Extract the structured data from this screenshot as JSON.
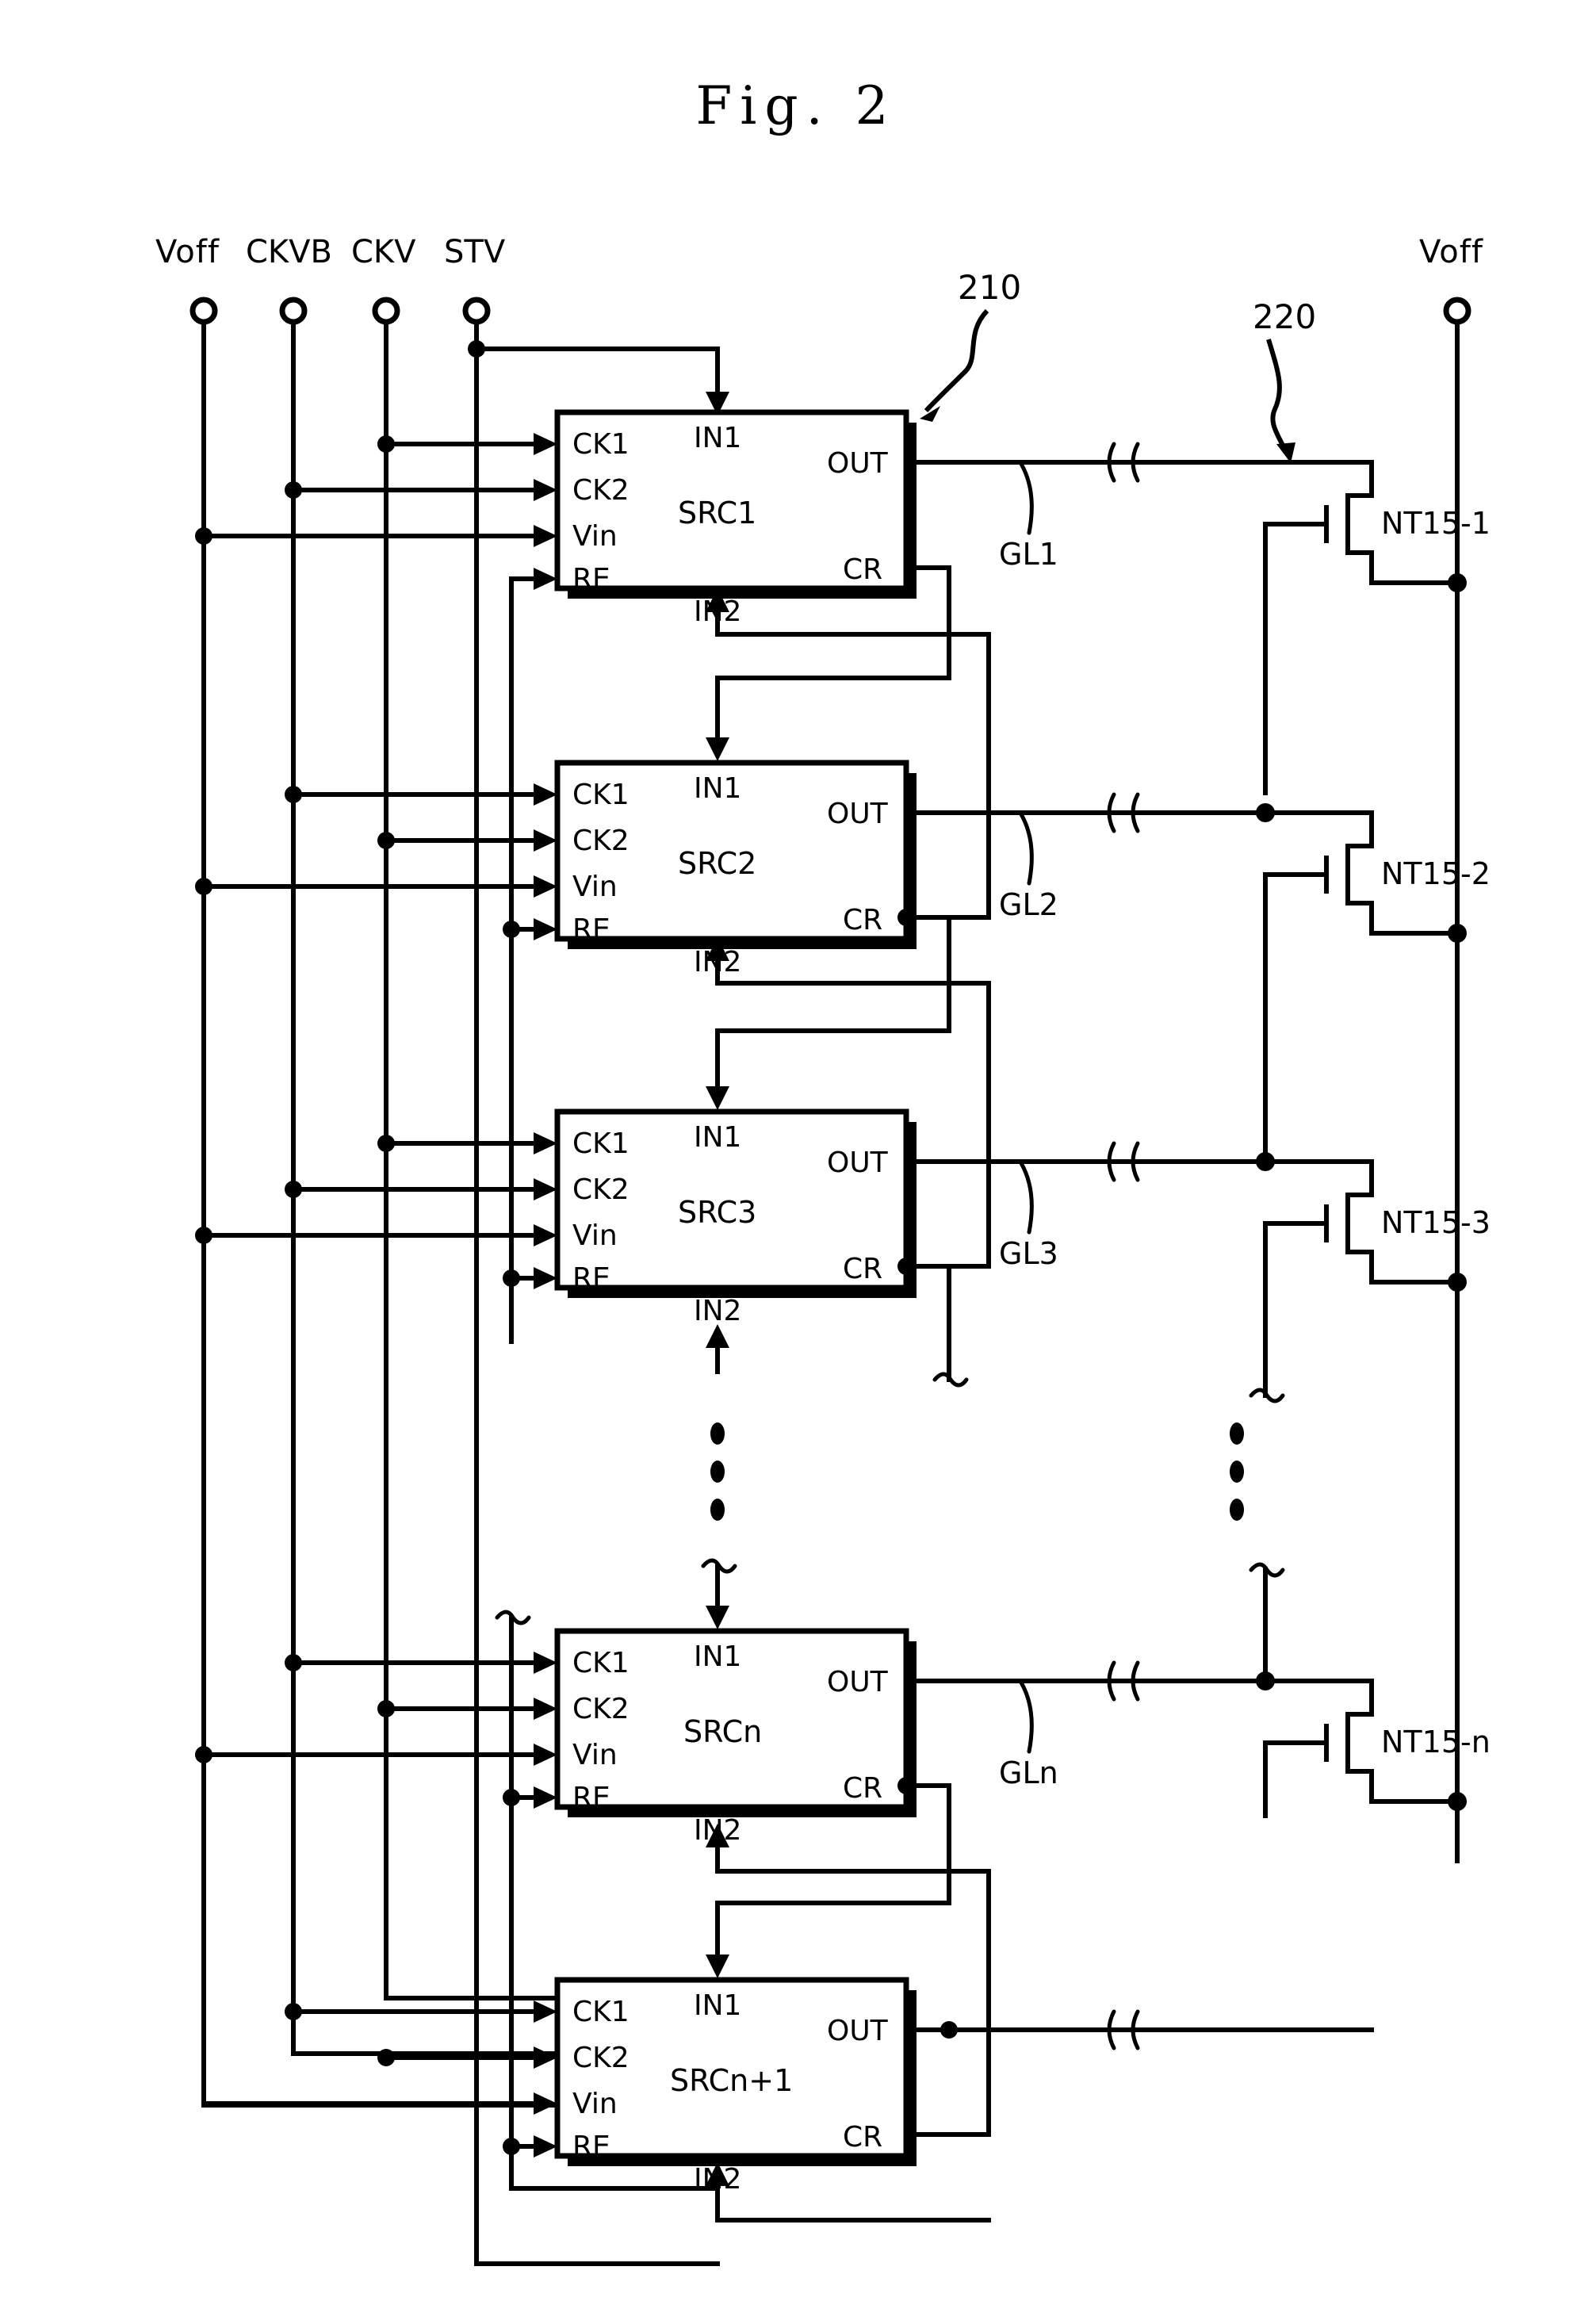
{
  "figure": {
    "title": "Fig. 2",
    "reference_numerals": [
      {
        "id": "ref-210",
        "text": "210"
      },
      {
        "id": "ref-220",
        "text": "220"
      }
    ]
  },
  "buses": {
    "left_terminals": [
      {
        "name": "Voff",
        "label": "Voff"
      },
      {
        "name": "CKVB",
        "label": "CKVB"
      },
      {
        "name": "CKV",
        "label": "CKV"
      },
      {
        "name": "STV",
        "label": "STV"
      }
    ],
    "right_terminal": {
      "name": "Voff",
      "label": "Voff"
    }
  },
  "stages": [
    {
      "name": "SRC1",
      "block_label": "SRC1",
      "inputs": {
        "ck1": "CK1",
        "ck2": "CK2",
        "vin": "Vin",
        "re": "RE",
        "in1": "IN1",
        "in2": "IN2"
      },
      "outputs": {
        "out": "OUT",
        "cr": "CR"
      },
      "gate_line": "GL1",
      "transistor": "NT15-1"
    },
    {
      "name": "SRC2",
      "block_label": "SRC2",
      "inputs": {
        "ck1": "CK1",
        "ck2": "CK2",
        "vin": "Vin",
        "re": "RE",
        "in1": "IN1",
        "in2": "IN2"
      },
      "outputs": {
        "out": "OUT",
        "cr": "CR"
      },
      "gate_line": "GL2",
      "transistor": "NT15-2"
    },
    {
      "name": "SRC3",
      "block_label": "SRC3",
      "inputs": {
        "ck1": "CK1",
        "ck2": "CK2",
        "vin": "Vin",
        "re": "RE",
        "in1": "IN1",
        "in2": "IN2"
      },
      "outputs": {
        "out": "OUT",
        "cr": "CR"
      },
      "gate_line": "GL3",
      "transistor": "NT15-3"
    },
    {
      "name": "SRCn",
      "block_label": "SRCn",
      "inputs": {
        "ck1": "CK1",
        "ck2": "CK2",
        "vin": "Vin",
        "re": "RE",
        "in1": "IN1",
        "in2": "IN2"
      },
      "outputs": {
        "out": "OUT",
        "cr": "CR"
      },
      "gate_line": "GLn",
      "transistor": "NT15-n"
    },
    {
      "name": "SRCn+1",
      "block_label": "SRCn+1",
      "inputs": {
        "ck1": "CK1",
        "ck2": "CK2",
        "vin": "Vin",
        "re": "RE",
        "in1": "IN1",
        "in2": "IN2"
      },
      "outputs": {
        "out": "OUT",
        "cr": "CR"
      },
      "gate_line": "",
      "transistor": ""
    }
  ],
  "colors": {
    "line": "#000000",
    "background": "#ffffff"
  }
}
